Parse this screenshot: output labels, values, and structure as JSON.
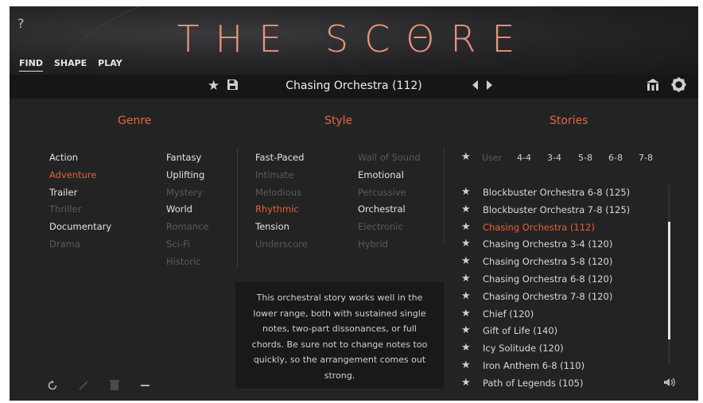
{
  "header": {
    "help": "?",
    "logo": "THE SCΘRE",
    "tabs": [
      "FIND",
      "SHAPE",
      "PLAY"
    ]
  },
  "toolbar": {
    "preset_name": "Chasing Orchestra (112)"
  },
  "genre": {
    "title": "Genre",
    "left": [
      {
        "label": "Action",
        "state": "normal"
      },
      {
        "label": "Adventure",
        "state": "active"
      },
      {
        "label": "Trailer",
        "state": "normal"
      },
      {
        "label": "Thriller",
        "state": "dim"
      },
      {
        "label": "Documentary",
        "state": "normal"
      },
      {
        "label": "Drama",
        "state": "dim"
      }
    ],
    "right": [
      {
        "label": "Fantasy",
        "state": "normal"
      },
      {
        "label": "Uplifting",
        "state": "normal"
      },
      {
        "label": "Mystery",
        "state": "dim"
      },
      {
        "label": "World",
        "state": "normal"
      },
      {
        "label": "Romance",
        "state": "dim"
      },
      {
        "label": "Sci-Fi",
        "state": "dim"
      },
      {
        "label": "Historic",
        "state": "dim"
      }
    ]
  },
  "style": {
    "title": "Style",
    "left": [
      {
        "label": "Fast-Paced",
        "state": "normal"
      },
      {
        "label": "Intimate",
        "state": "dim"
      },
      {
        "label": "Melodious",
        "state": "dim"
      },
      {
        "label": "Rhythmic",
        "state": "active"
      },
      {
        "label": "Tension",
        "state": "normal"
      },
      {
        "label": "Underscore",
        "state": "dim"
      }
    ],
    "right": [
      {
        "label": "Wall of Sound",
        "state": "dim"
      },
      {
        "label": "Emotional",
        "state": "normal"
      },
      {
        "label": "Percussive",
        "state": "dim"
      },
      {
        "label": "Orchestral",
        "state": "normal"
      },
      {
        "label": "Electronic",
        "state": "dim"
      },
      {
        "label": "Hybrid",
        "state": "dim"
      }
    ]
  },
  "stories": {
    "title": "Stories",
    "filters": [
      "User",
      "4-4",
      "3-4",
      "5-8",
      "6-8",
      "7-8"
    ],
    "items": [
      {
        "label": "Blockbuster Orchestra 6-8 (125)",
        "active": false
      },
      {
        "label": "Blockbuster Orchestra 7-8 (125)",
        "active": false
      },
      {
        "label": "Chasing Orchestra (112)",
        "active": true
      },
      {
        "label": "Chasing Orchestra 3-4 (120)",
        "active": false
      },
      {
        "label": "Chasing Orchestra 5-8 (120)",
        "active": false
      },
      {
        "label": "Chasing Orchestra 6-8 (120)",
        "active": false
      },
      {
        "label": "Chasing Orchestra 7-8 (120)",
        "active": false
      },
      {
        "label": "Chief (120)",
        "active": false
      },
      {
        "label": "Gift of Life (140)",
        "active": false
      },
      {
        "label": "Icy Solitude (120)",
        "active": false
      },
      {
        "label": "Iron Anthem 6-8 (110)",
        "active": false
      },
      {
        "label": "Path of Legends (105)",
        "active": false
      }
    ]
  },
  "description": "This orchestral story works well in the lower range, both with sustained single notes, two-part dissonances, or full chords. Be sure not to change notes too quickly, so the arrangement comes out strong.",
  "colors": {
    "accent": "#e06236",
    "logo": "#e8957c",
    "background": "#232324"
  }
}
